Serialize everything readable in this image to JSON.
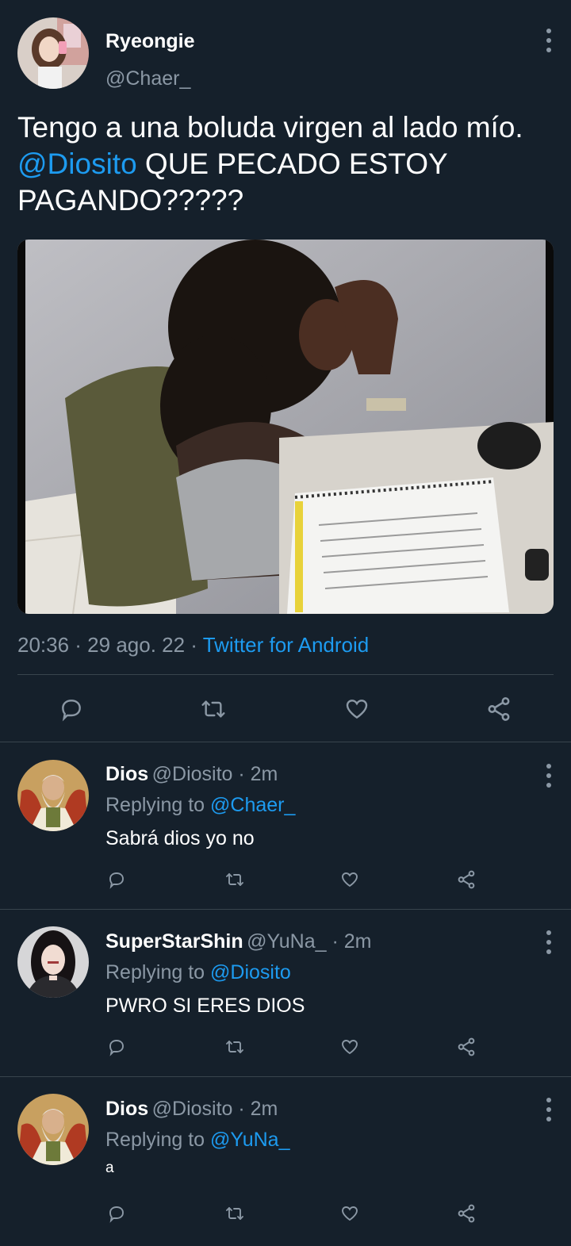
{
  "main_tweet": {
    "author_name": "Ryeongie",
    "author_handle": "@Chaer_",
    "text_part1": "Tengo a una boluda virgen al lado mío. ",
    "mention": "@Diosito",
    "text_part2": " QUE PECADO ESTOY PAGANDO?????",
    "timestamp": "20:36 · 29 ago. 22 · ",
    "source": "Twitter for Android",
    "media_icon": "photo-girl-studying"
  },
  "replies": [
    {
      "name": "Dios",
      "handle": "@Diosito",
      "time": " · 2m",
      "replying_label": "Replying to ",
      "replying_to": "@Chaer_",
      "text": "Sabrá dios yo no"
    },
    {
      "name": "SuperStarShin",
      "handle": "@YuNa_",
      "time": " · 2m",
      "replying_label": "Replying to ",
      "replying_to": "@Diosito",
      "text": "PWRO SI ERES DIOS"
    },
    {
      "name": "Dios",
      "handle": "@Diosito",
      "time": " · 2m",
      "replying_label": "Replying to ",
      "replying_to": "@YuNa_",
      "text": "a"
    }
  ],
  "icons": {
    "reply": "reply-icon",
    "retweet": "retweet-icon",
    "like": "heart-icon",
    "share": "share-icon",
    "more": "more-vertical-icon"
  },
  "colors": {
    "background": "#15202b",
    "accent": "#1d9bf0",
    "secondary_text": "#8b98a5",
    "divider": "#38444d"
  }
}
